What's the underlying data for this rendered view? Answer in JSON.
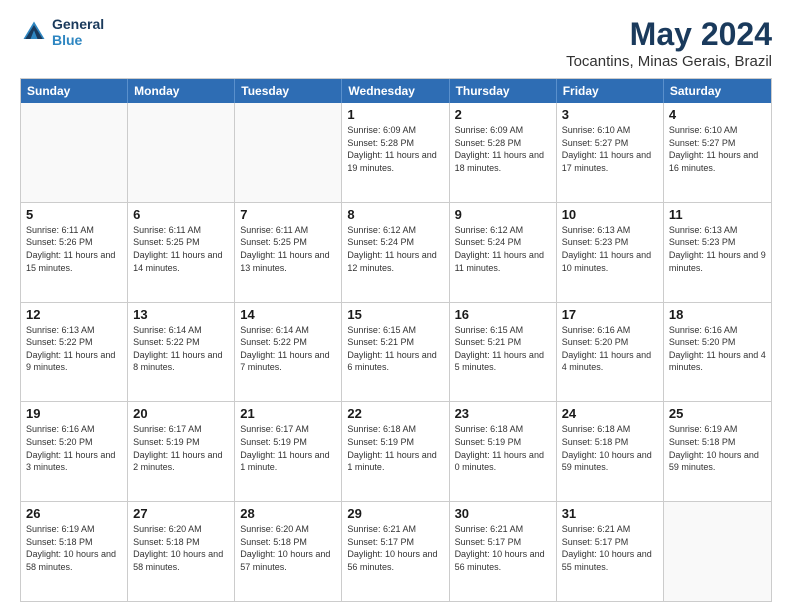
{
  "logo": {
    "line1": "General",
    "line2": "Blue"
  },
  "title": "May 2024",
  "subtitle": "Tocantins, Minas Gerais, Brazil",
  "header_days": [
    "Sunday",
    "Monday",
    "Tuesday",
    "Wednesday",
    "Thursday",
    "Friday",
    "Saturday"
  ],
  "weeks": [
    [
      {
        "day": "",
        "info": ""
      },
      {
        "day": "",
        "info": ""
      },
      {
        "day": "",
        "info": ""
      },
      {
        "day": "1",
        "info": "Sunrise: 6:09 AM\nSunset: 5:28 PM\nDaylight: 11 hours and 19 minutes."
      },
      {
        "day": "2",
        "info": "Sunrise: 6:09 AM\nSunset: 5:28 PM\nDaylight: 11 hours and 18 minutes."
      },
      {
        "day": "3",
        "info": "Sunrise: 6:10 AM\nSunset: 5:27 PM\nDaylight: 11 hours and 17 minutes."
      },
      {
        "day": "4",
        "info": "Sunrise: 6:10 AM\nSunset: 5:27 PM\nDaylight: 11 hours and 16 minutes."
      }
    ],
    [
      {
        "day": "5",
        "info": "Sunrise: 6:11 AM\nSunset: 5:26 PM\nDaylight: 11 hours and 15 minutes."
      },
      {
        "day": "6",
        "info": "Sunrise: 6:11 AM\nSunset: 5:25 PM\nDaylight: 11 hours and 14 minutes."
      },
      {
        "day": "7",
        "info": "Sunrise: 6:11 AM\nSunset: 5:25 PM\nDaylight: 11 hours and 13 minutes."
      },
      {
        "day": "8",
        "info": "Sunrise: 6:12 AM\nSunset: 5:24 PM\nDaylight: 11 hours and 12 minutes."
      },
      {
        "day": "9",
        "info": "Sunrise: 6:12 AM\nSunset: 5:24 PM\nDaylight: 11 hours and 11 minutes."
      },
      {
        "day": "10",
        "info": "Sunrise: 6:13 AM\nSunset: 5:23 PM\nDaylight: 11 hours and 10 minutes."
      },
      {
        "day": "11",
        "info": "Sunrise: 6:13 AM\nSunset: 5:23 PM\nDaylight: 11 hours and 9 minutes."
      }
    ],
    [
      {
        "day": "12",
        "info": "Sunrise: 6:13 AM\nSunset: 5:22 PM\nDaylight: 11 hours and 9 minutes."
      },
      {
        "day": "13",
        "info": "Sunrise: 6:14 AM\nSunset: 5:22 PM\nDaylight: 11 hours and 8 minutes."
      },
      {
        "day": "14",
        "info": "Sunrise: 6:14 AM\nSunset: 5:22 PM\nDaylight: 11 hours and 7 minutes."
      },
      {
        "day": "15",
        "info": "Sunrise: 6:15 AM\nSunset: 5:21 PM\nDaylight: 11 hours and 6 minutes."
      },
      {
        "day": "16",
        "info": "Sunrise: 6:15 AM\nSunset: 5:21 PM\nDaylight: 11 hours and 5 minutes."
      },
      {
        "day": "17",
        "info": "Sunrise: 6:16 AM\nSunset: 5:20 PM\nDaylight: 11 hours and 4 minutes."
      },
      {
        "day": "18",
        "info": "Sunrise: 6:16 AM\nSunset: 5:20 PM\nDaylight: 11 hours and 4 minutes."
      }
    ],
    [
      {
        "day": "19",
        "info": "Sunrise: 6:16 AM\nSunset: 5:20 PM\nDaylight: 11 hours and 3 minutes."
      },
      {
        "day": "20",
        "info": "Sunrise: 6:17 AM\nSunset: 5:19 PM\nDaylight: 11 hours and 2 minutes."
      },
      {
        "day": "21",
        "info": "Sunrise: 6:17 AM\nSunset: 5:19 PM\nDaylight: 11 hours and 1 minute."
      },
      {
        "day": "22",
        "info": "Sunrise: 6:18 AM\nSunset: 5:19 PM\nDaylight: 11 hours and 1 minute."
      },
      {
        "day": "23",
        "info": "Sunrise: 6:18 AM\nSunset: 5:19 PM\nDaylight: 11 hours and 0 minutes."
      },
      {
        "day": "24",
        "info": "Sunrise: 6:18 AM\nSunset: 5:18 PM\nDaylight: 10 hours and 59 minutes."
      },
      {
        "day": "25",
        "info": "Sunrise: 6:19 AM\nSunset: 5:18 PM\nDaylight: 10 hours and 59 minutes."
      }
    ],
    [
      {
        "day": "26",
        "info": "Sunrise: 6:19 AM\nSunset: 5:18 PM\nDaylight: 10 hours and 58 minutes."
      },
      {
        "day": "27",
        "info": "Sunrise: 6:20 AM\nSunset: 5:18 PM\nDaylight: 10 hours and 58 minutes."
      },
      {
        "day": "28",
        "info": "Sunrise: 6:20 AM\nSunset: 5:18 PM\nDaylight: 10 hours and 57 minutes."
      },
      {
        "day": "29",
        "info": "Sunrise: 6:21 AM\nSunset: 5:17 PM\nDaylight: 10 hours and 56 minutes."
      },
      {
        "day": "30",
        "info": "Sunrise: 6:21 AM\nSunset: 5:17 PM\nDaylight: 10 hours and 56 minutes."
      },
      {
        "day": "31",
        "info": "Sunrise: 6:21 AM\nSunset: 5:17 PM\nDaylight: 10 hours and 55 minutes."
      },
      {
        "day": "",
        "info": ""
      }
    ]
  ]
}
